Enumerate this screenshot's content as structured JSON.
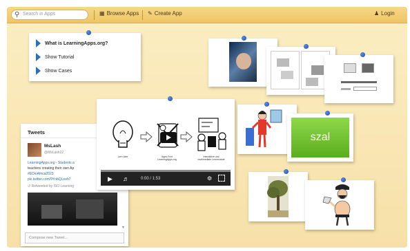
{
  "colors": {
    "accent": "#2a6fb8",
    "board": "#f7e0a8",
    "topbar": "#eec564",
    "szal_green": "#6fc52a"
  },
  "topbar": {
    "search_placeholder": "Search in Apps",
    "browse_label": "Browse Apps",
    "create_label": "Create App",
    "login_label": "Login",
    "icons": {
      "search": "search-icon",
      "browse": "grid-icon",
      "create": "pencil-icon",
      "login": "user-icon"
    }
  },
  "menu": {
    "items": [
      {
        "label": "What is LearningApps.org?"
      },
      {
        "label": "Show Tutorial"
      },
      {
        "label": "Show Cases"
      }
    ]
  },
  "tweets": {
    "title": "Tweets",
    "author_name": "MsLash",
    "author_handle": "@MsLash22",
    "lines": [
      "LearningApps.org - Students a",
      "teachers creating their own Ap",
      "#EDinAfrica2023",
      "pic.twitter.com/9YnbQLeeh7"
    ],
    "retweet_note": "Retweeted by ISO Learning",
    "compose_placeholder": "Compose new Tweet..."
  },
  "video": {
    "time_display": "0:00 / 1:53",
    "captions": [
      "Lern Idee",
      "Apps Frzd LearningApps.org",
      "Interaktive und multimediale Lernmodule"
    ]
  },
  "szal_card": {
    "text": "szal"
  }
}
